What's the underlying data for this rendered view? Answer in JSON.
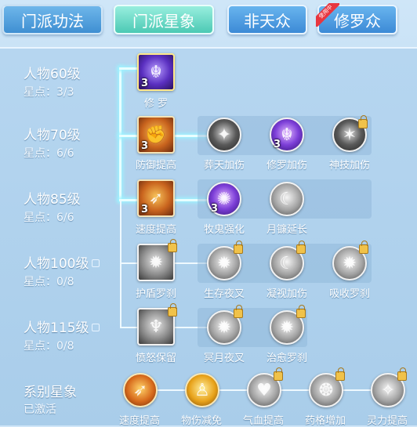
{
  "tabs": [
    {
      "label": "门派功法"
    },
    {
      "label": "门派星象"
    },
    {
      "label": "非天众"
    },
    {
      "label": "修罗众",
      "badge": "使用中"
    }
  ],
  "levels": [
    {
      "name": "人物60级",
      "stars": "星点：3/3",
      "locked": false
    },
    {
      "name": "人物70级",
      "stars": "星点：6/6",
      "locked": false
    },
    {
      "name": "人物85级",
      "stars": "星点：6/6",
      "locked": false
    },
    {
      "name": "人物100级",
      "stars": "星点：0/8",
      "locked": true
    },
    {
      "name": "人物115级",
      "stars": "星点：0/8",
      "locked": true
    }
  ],
  "nodes": {
    "row1": {
      "main": {
        "label": "修 罗",
        "count": "3",
        "icon": "demon-face-icon"
      }
    },
    "row2": {
      "main": {
        "label": "防御提高",
        "count": "3",
        "icon": "muscle-arm-icon"
      },
      "subs": [
        {
          "label": "葬天加伤",
          "count": "",
          "icon": "slash-icon",
          "locked": false
        },
        {
          "label": "修罗加伤",
          "count": "3",
          "icon": "demon-face-icon",
          "locked": false
        },
        {
          "label": "神技加伤",
          "count": "",
          "icon": "claw-icon",
          "locked": true
        }
      ]
    },
    "row3": {
      "main": {
        "label": "速度提高",
        "count": "3",
        "icon": "running-icon"
      },
      "subs": [
        {
          "label": "牧鬼强化",
          "count": "3",
          "icon": "chest-icon",
          "locked": false
        },
        {
          "label": "月镰延长",
          "count": "",
          "icon": "sickle-icon",
          "locked": false
        }
      ]
    },
    "row4": {
      "main": {
        "label": "护盾罗刹",
        "count": "",
        "icon": "beast-icon",
        "locked": true
      },
      "subs": [
        {
          "label": "生存夜叉",
          "count": "",
          "icon": "beast-icon",
          "locked": true
        },
        {
          "label": "凝视加伤",
          "count": "",
          "icon": "moon-icon",
          "locked": true
        },
        {
          "label": "吸收罗刹",
          "count": "",
          "icon": "beast-icon",
          "locked": true
        }
      ]
    },
    "row5": {
      "main": {
        "label": "愤怒保留",
        "count": "",
        "icon": "winged-demon-icon",
        "locked": true
      },
      "subs": [
        {
          "label": "冥月夜叉",
          "count": "",
          "icon": "beast-icon",
          "locked": true
        },
        {
          "label": "治愈罗刹",
          "count": "",
          "icon": "beast-icon",
          "locked": true
        }
      ]
    }
  },
  "series": {
    "title": "系别星象",
    "status": "已激活",
    "items": [
      {
        "label": "速度提高",
        "icon": "running-icon",
        "locked": false
      },
      {
        "label": "物伤减免",
        "icon": "figure-icon",
        "locked": false
      },
      {
        "label": "气血提高",
        "icon": "heart-icon",
        "locked": true
      },
      {
        "label": "药格增加",
        "icon": "pill-icon",
        "locked": true
      },
      {
        "label": "灵力提高",
        "icon": "spirit-icon",
        "locked": true
      }
    ]
  },
  "colors": {
    "active_tab": "#4cc9b4",
    "tab": "#3f8fd2",
    "badge": "#e8363f",
    "lock": "#f0c24a"
  }
}
